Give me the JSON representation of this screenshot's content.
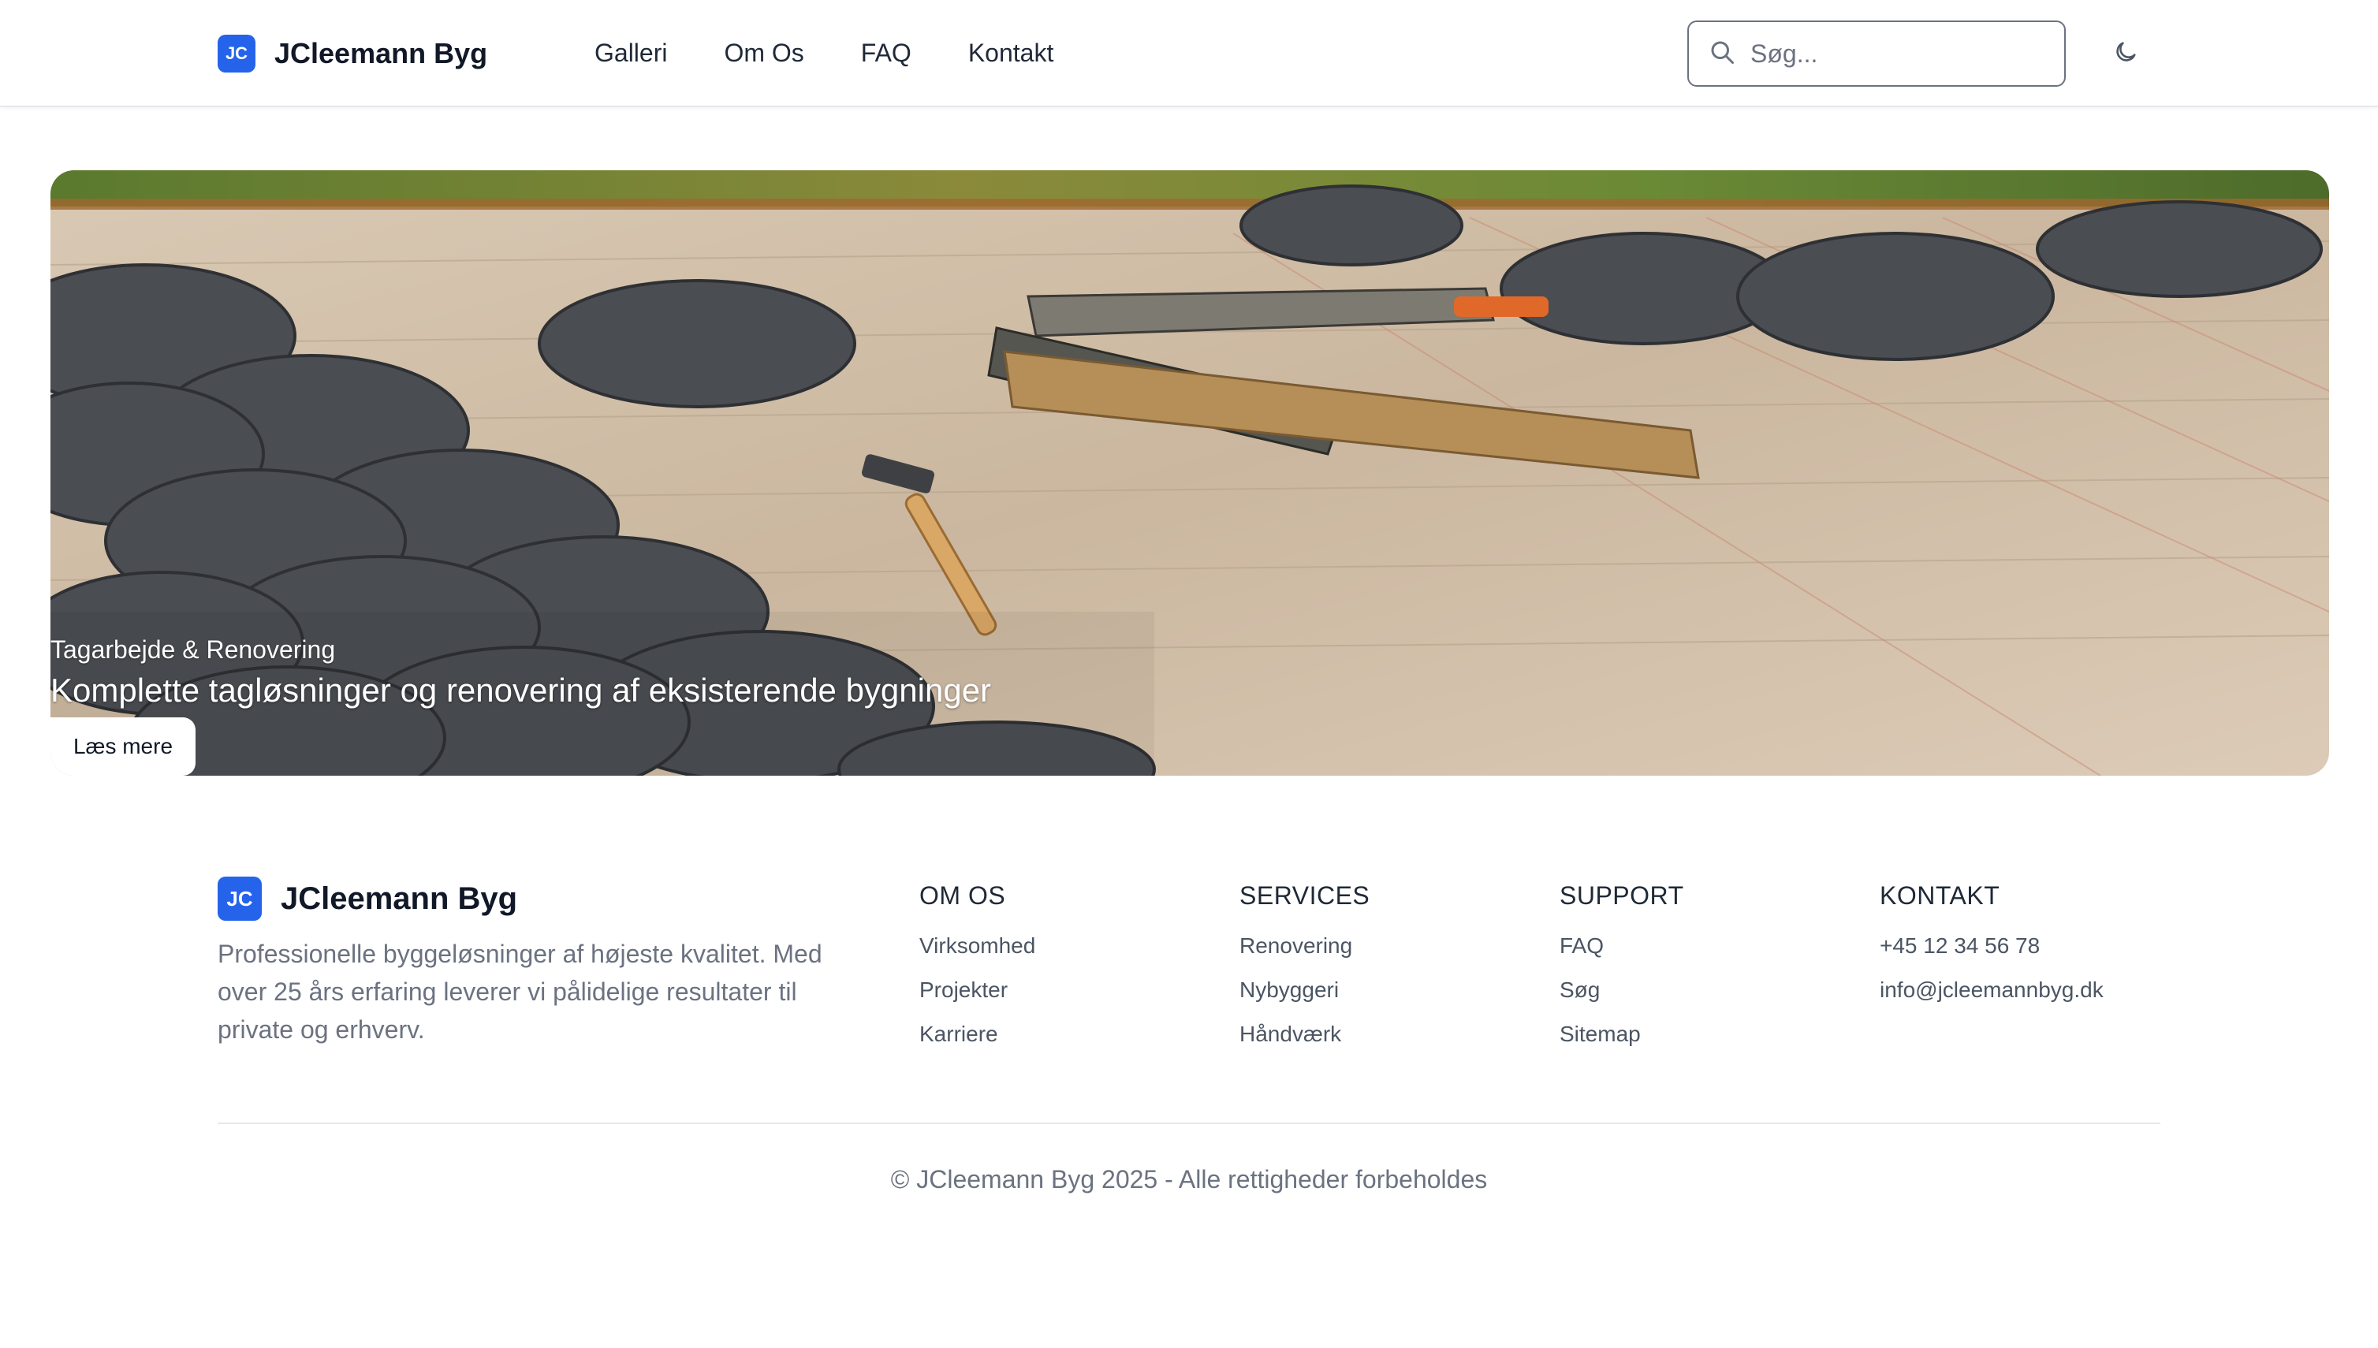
{
  "header": {
    "logo_text": "JC",
    "brand": "JCleemann Byg",
    "nav": [
      "Galleri",
      "Om Os",
      "FAQ",
      "Kontakt"
    ],
    "search_placeholder": "Søg...",
    "theme_icon": "moon-icon"
  },
  "hero": {
    "subtitle": "Tagarbejde & Renovering",
    "title": "Komplette tagløsninger og renovering af eksisterende bygninger",
    "button": "Læs mere",
    "image": "roof-slate-tiles-with-hammer-and-cutter"
  },
  "footer": {
    "logo_text": "JC",
    "brand": "JCleemann Byg",
    "description": "Professionelle byggeløsninger af højeste kvalitet. Med over 25 års erfaring leverer vi pålidelige resultater til private og erhverv.",
    "columns": [
      {
        "heading": "OM OS",
        "links": [
          "Virksomhed",
          "Projekter",
          "Karriere"
        ]
      },
      {
        "heading": "SERVICES",
        "links": [
          "Renovering",
          "Nybyggeri",
          "Håndværk"
        ]
      },
      {
        "heading": "SUPPORT",
        "links": [
          "FAQ",
          "Søg",
          "Sitemap"
        ]
      },
      {
        "heading": "KONTAKT",
        "links": [
          "+45 12 34 56 78",
          "info@jcleemannbyg.dk"
        ]
      }
    ],
    "copyright": "© JCleemann Byg 2025 - Alle rettigheder forbeholdes"
  },
  "colors": {
    "accent": "#2563eb",
    "text": "#1f2937",
    "muted": "#6b7280"
  }
}
